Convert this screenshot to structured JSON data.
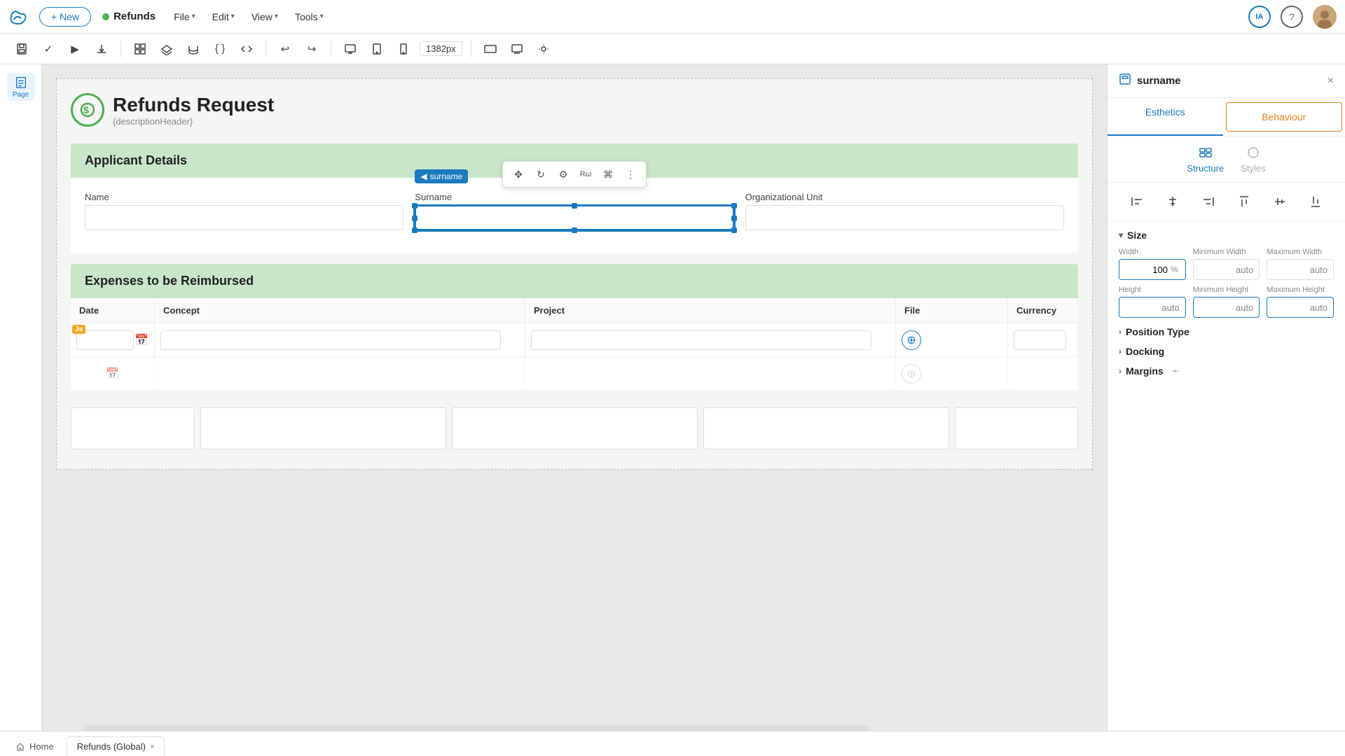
{
  "topbar": {
    "new_label": "+ New",
    "doc_name": "Refunds",
    "file_label": "File",
    "edit_label": "Edit",
    "view_label": "View",
    "tools_label": "Tools",
    "ia_badge": "IA",
    "help_symbol": "?"
  },
  "toolbar": {
    "viewport_size": "1382px"
  },
  "left_sidebar": {
    "page_label": "Page"
  },
  "form": {
    "title": "Refunds Request",
    "subtitle": "{descriptionHeader}",
    "applicant_section": "Applicant Details",
    "name_label": "Name",
    "surname_label": "Surname",
    "org_unit_label": "Organizational Unit",
    "expenses_section": "Expenses to be Reimbursed",
    "table_headers": [
      "Date",
      "Concept",
      "Project",
      "File",
      "Currency"
    ]
  },
  "selection": {
    "tag_label": "surname",
    "tag_arrow": "<"
  },
  "right_panel": {
    "element_label": "surname",
    "close_symbol": "×",
    "tab_esthetics": "Esthetics",
    "tab_behaviour": "Behaviour",
    "sub_tab_structure": "Structure",
    "sub_tab_styles": "Styles",
    "size_section": "Size",
    "width_label": "Width",
    "width_value": "100",
    "width_unit": "%",
    "min_width_label": "Minimum Width",
    "min_width_value": "auto",
    "max_width_label": "Maximum Width",
    "max_width_value": "auto",
    "height_label": "Height",
    "height_value": "auto",
    "min_height_label": "Minimum Height",
    "min_height_value": "auto",
    "max_height_label": "Maximum Height",
    "max_height_value": "auto",
    "position_type_label": "Position Type",
    "docking_label": "Docking",
    "margins_label": "Margins"
  },
  "bottom_bar": {
    "home_label": "Home",
    "tab_label": "Refunds (Global)",
    "close_symbol": "×"
  }
}
